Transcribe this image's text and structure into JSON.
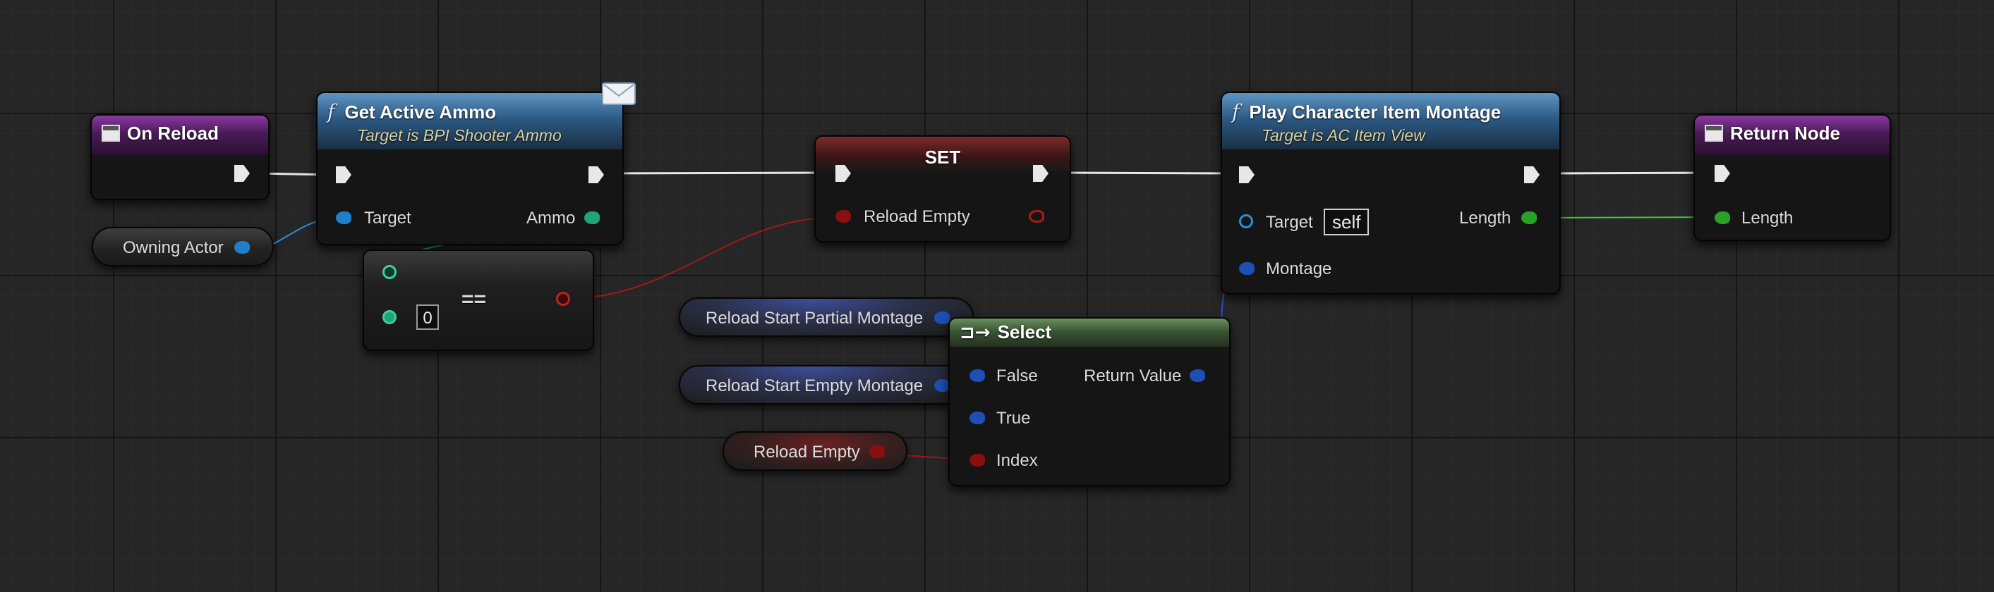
{
  "nodes": {
    "on_reload": {
      "title": "On Reload"
    },
    "get_active_ammo": {
      "title": "Get Active Ammo",
      "subtitle": "Target is BPI Shooter Ammo",
      "target_label": "Target",
      "output_label": "Ammo"
    },
    "set_node": {
      "title": "SET",
      "input_label": "Reload Empty"
    },
    "play_montage": {
      "title": "Play Character Item Montage",
      "subtitle": "Target is AC Item View",
      "target_label": "Target",
      "target_value": "self",
      "montage_label": "Montage",
      "output_label": "Length"
    },
    "return_node": {
      "title": "Return Node",
      "length_label": "Length"
    },
    "equals_node": {
      "operator": "==",
      "default_value": "0"
    },
    "select_node": {
      "title": "Select",
      "false_label": "False",
      "true_label": "True",
      "index_label": "Index",
      "return_label": "Return Value"
    }
  },
  "variables": {
    "owning_actor": "Owning Actor",
    "reload_start_partial": "Reload Start Partial Montage",
    "reload_start_empty": "Reload Start Empty Montage",
    "reload_empty": "Reload Empty"
  },
  "icons": {
    "function": "function-icon",
    "event": "event-icon",
    "return": "return-icon",
    "select": "select-icon",
    "message": "envelope-icon"
  },
  "colors": {
    "background": "#262626",
    "exec_wire": "#e8e8e8",
    "object_pin": "#1f7fc8",
    "int_pin": "#1fa37a",
    "bool_pin": "#8a1010",
    "float_pin": "#29a028",
    "montage_pin": "#1d4fb4",
    "function_header": "#2c5a85",
    "event_header": "#8a3aa0",
    "select_header": "#3a5634"
  }
}
